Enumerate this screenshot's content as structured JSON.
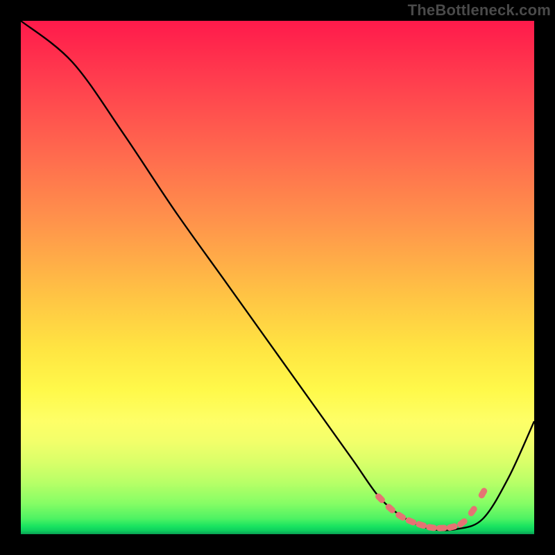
{
  "watermark": "TheBottleneck.com",
  "chart_data": {
    "type": "line",
    "title": "",
    "xlabel": "",
    "ylabel": "",
    "xlim": [
      0,
      100
    ],
    "ylim": [
      0,
      100
    ],
    "series": [
      {
        "name": "curve",
        "x": [
          0,
          10,
          20,
          30,
          40,
          50,
          60,
          65,
          70,
          75,
          80,
          85,
          90,
          95,
          100
        ],
        "y": [
          100,
          92,
          78,
          63,
          49,
          35,
          21,
          14,
          7,
          3,
          1,
          1,
          3,
          11,
          22
        ]
      }
    ],
    "markers": {
      "name": "highlight",
      "x": [
        70,
        72,
        74,
        76,
        78,
        80,
        82,
        84,
        86,
        88,
        90
      ],
      "y": [
        7,
        5,
        3.5,
        2.5,
        1.8,
        1.3,
        1.2,
        1.4,
        2.2,
        4.5,
        8
      ]
    },
    "colors": {
      "curve_stroke": "#000000",
      "marker_fill": "#e57373",
      "gradient_top": "#ff1a4b",
      "gradient_mid": "#ffe542",
      "gradient_bottom": "#0aa154"
    }
  }
}
